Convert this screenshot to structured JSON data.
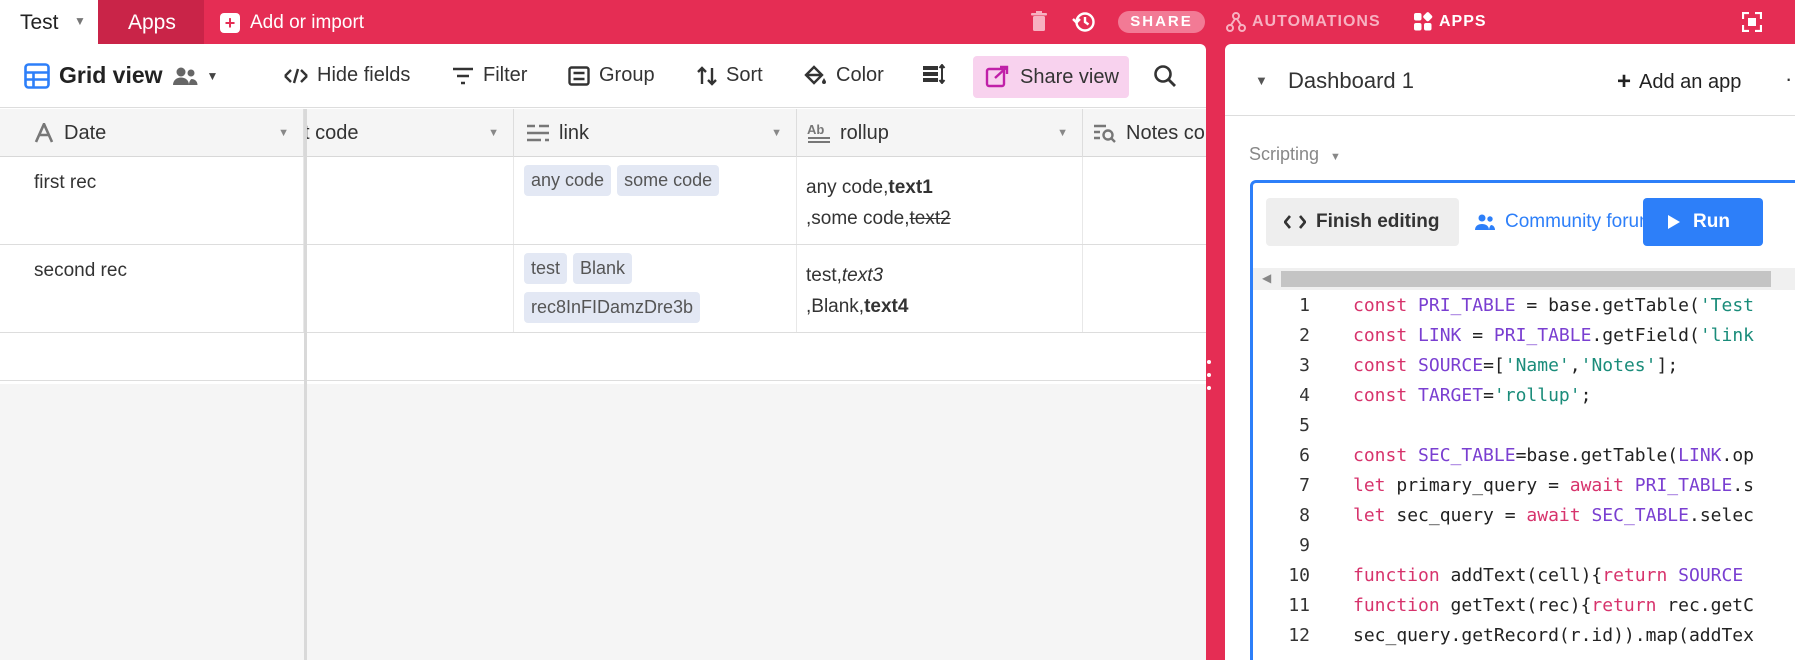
{
  "topbar": {
    "tab_test": "Test",
    "tab_apps": "Apps",
    "add_import": "Add or import",
    "share": "SHARE",
    "automations": "AUTOMATIONS",
    "apps": "APPS"
  },
  "toolbar": {
    "grid_view": "Grid view",
    "hide_fields": "Hide fields",
    "filter": "Filter",
    "group": "Group",
    "sort": "Sort",
    "color": "Color",
    "share_view": "Share view"
  },
  "grid": {
    "columns": [
      "Date",
      "t code",
      "link",
      "rollup",
      "Notes co"
    ],
    "rows": [
      {
        "name": "first rec",
        "links": [
          "any code",
          "some code"
        ],
        "rollup_line1_plain": "any code,",
        "rollup_line1_styled": "text1",
        "rollup_line2_plain": ",some code,",
        "rollup_line2_styled": "text2"
      },
      {
        "name": "second rec",
        "links": [
          "test",
          "Blank",
          "rec8InFIDamzDre3b"
        ],
        "rollup_line1_plain": "test,",
        "rollup_line1_styled": "text3",
        "rollup_line2_plain": ",Blank,",
        "rollup_line2_styled": "text4"
      }
    ]
  },
  "dashboard": {
    "title": "Dashboard 1",
    "add_app": "Add an app",
    "app_type": "Scripting",
    "finish_editing": "Finish editing",
    "community_forum": "Community forum",
    "run": "Run"
  },
  "code_lines": [
    "const PRI_TABLE = base.getTable('Test",
    "const LINK = PRI_TABLE.getField('link",
    "const SOURCE=['Name','Notes'];",
    "const TARGET='rollup';",
    "",
    "const SEC_TABLE=base.getTable(LINK.op",
    "let primary_query = await PRI_TABLE.s",
    "let sec_query = await SEC_TABLE.selec",
    "",
    "function addText(cell){return SOURCE",
    "function getText(rec){return rec.getC",
    "sec_query.getRecord(r.id)).map(addTex"
  ],
  "colors": {
    "brand": "#e52d54",
    "accent_blue": "#2d7ff9",
    "share_view_bg": "#f8d2ee"
  }
}
